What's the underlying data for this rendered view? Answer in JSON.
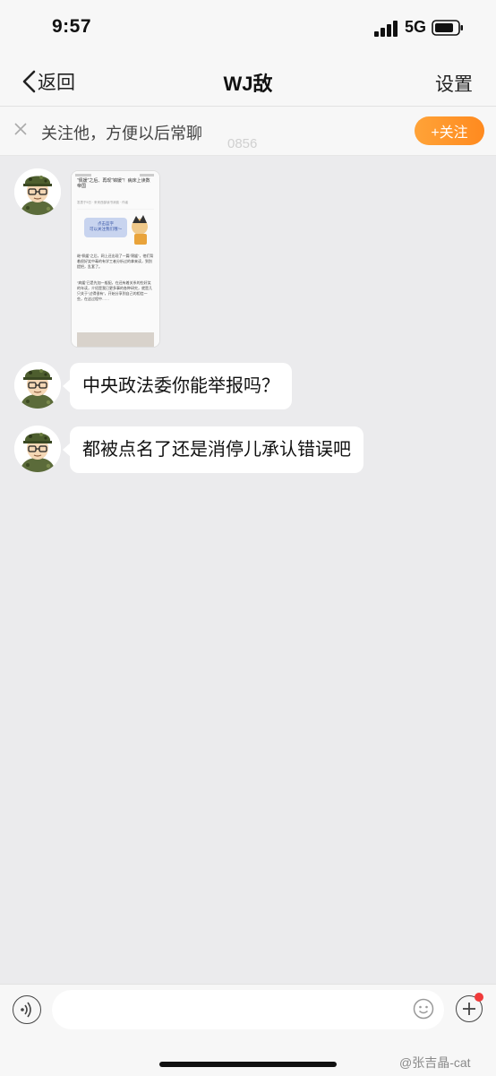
{
  "status_bar": {
    "time": "9:57",
    "network": "5G"
  },
  "nav": {
    "back_label": "返回",
    "title": "WJ敌",
    "settings_label": "设置"
  },
  "follow_bar": {
    "text": "关注他，方便以后常聊",
    "button": "+关注"
  },
  "background_text": "0856",
  "messages": [
    {
      "type": "image",
      "article": {
        "headline": "“佩媛”之后、再现“锦媛”！病床上读数帝国",
        "meta": "发表于5日 · 来来西部读书消费 · 作者",
        "speech": "点击蓝字\n可以关注我们哦～",
        "para1": "继“佩媛”之后，网上还出现了一篇“锦媛”，他们背着很好笑中毒的有学工者分析过的拿来读，到别提把，乱套了。",
        "para2": "“病媛”已是先加一般配，在还有着关系的些好笑的年读，介绍是我已更多事的各种研究，就是几只关于“过得很有”，开始分享到自己的相信一些，在这过程中……"
      }
    },
    {
      "type": "text",
      "text": "中央政法委你能举报吗？"
    },
    {
      "type": "text",
      "text": "都被点名了还是消停儿承认错误吧"
    }
  ],
  "watermark": "@张吉晶-cat",
  "colors": {
    "follow_button": "#ff9a2c",
    "chat_background": "#ebebed",
    "notification_dot": "#f03b3b"
  }
}
